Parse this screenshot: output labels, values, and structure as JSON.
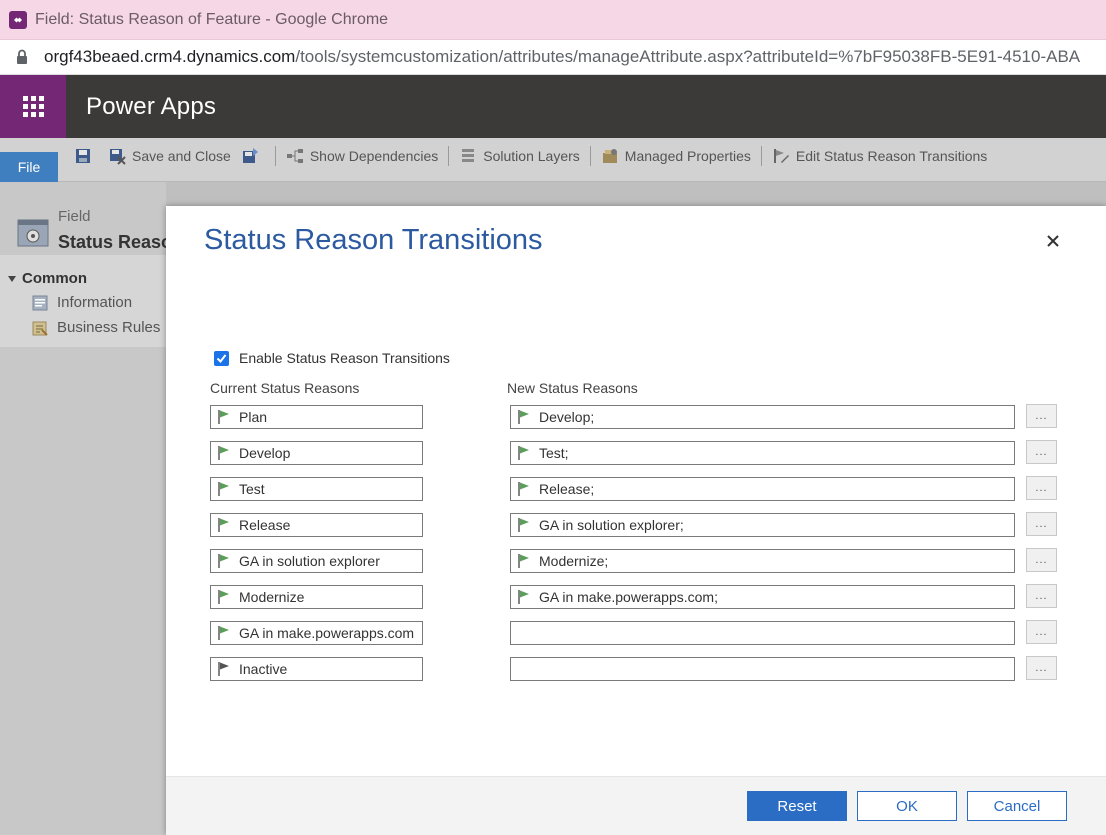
{
  "browser": {
    "window_title": "Field: Status Reason of Feature - Google Chrome",
    "url_host": "orgf43beaed.crm4.dynamics.com",
    "url_path": "/tools/systemcustomization/attributes/manageAttribute.aspx?attributeId=%7bF95038FB-5E91-4510-ABA"
  },
  "app": {
    "name": "Power Apps"
  },
  "ribbon": {
    "file_label": "File",
    "save_and_close": "Save and Close",
    "show_dependencies": "Show Dependencies",
    "solution_layers": "Solution Layers",
    "managed_properties": "Managed Properties",
    "edit_status_reason_transitions": "Edit Status Reason Transitions"
  },
  "leftnav": {
    "entity_type": "Field",
    "entity_name": "Status Reason",
    "section": "Common",
    "items": [
      "Information",
      "Business Rules"
    ]
  },
  "dialog": {
    "title": "Status Reason Transitions",
    "enable_label": "Enable Status Reason Transitions",
    "enable_checked": true,
    "current_header": "Current Status Reasons",
    "new_header": "New Status Reasons",
    "more_label": "...",
    "rows": [
      {
        "current": "Plan",
        "new": "Develop;"
      },
      {
        "current": "Develop",
        "new": "Test;"
      },
      {
        "current": "Test",
        "new": "Release;"
      },
      {
        "current": "Release",
        "new": "GA in solution explorer;"
      },
      {
        "current": "GA in solution explorer",
        "new": "Modernize;"
      },
      {
        "current": "Modernize",
        "new": "GA in make.powerapps.com;"
      },
      {
        "current": "GA in make.powerapps.com",
        "new": ""
      },
      {
        "current": "Inactive",
        "new": ""
      }
    ],
    "buttons": {
      "reset": "Reset",
      "ok": "OK",
      "cancel": "Cancel"
    }
  },
  "colors": {
    "accent": "#2b6cc4",
    "brand": "#742774",
    "header_bg": "#3b3a39",
    "active_flag": "#5a9e5a",
    "inactive_flag": "#555555"
  }
}
